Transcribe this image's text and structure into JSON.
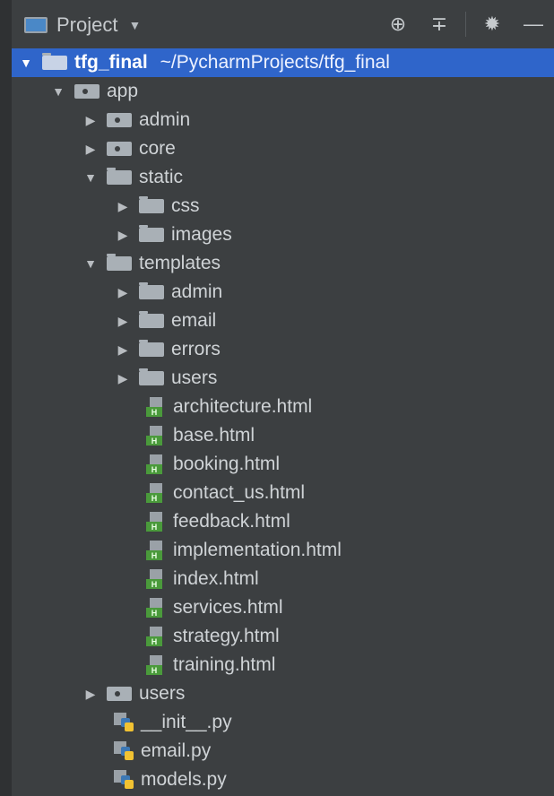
{
  "toolbar": {
    "title": "Project",
    "icons": [
      "project-panel-icon",
      "dropdown-caret-icon",
      "locate-icon",
      "collapse-all-icon",
      "settings-icon",
      "minimize-icon"
    ]
  },
  "tree": {
    "root": {
      "name": "tfg_final",
      "path": "~/PycharmProjects/tfg_final"
    },
    "app": "app",
    "admin": "admin",
    "core": "core",
    "static": "static",
    "css": "css",
    "images": "images",
    "templates": "templates",
    "tpl_admin": "admin",
    "tpl_email": "email",
    "tpl_errors": "errors",
    "tpl_users": "users",
    "html_files": [
      "architecture.html",
      "base.html",
      "booking.html",
      "contact_us.html",
      "feedback.html",
      "implementation.html",
      "index.html",
      "services.html",
      "strategy.html",
      "training.html"
    ],
    "users": "users",
    "py_files": [
      "__init__.py",
      "email.py",
      "models.py"
    ]
  },
  "colors": {
    "selection": "#2f65ca",
    "background": "#3c3f41",
    "html_badge": "#4a9a3b"
  }
}
